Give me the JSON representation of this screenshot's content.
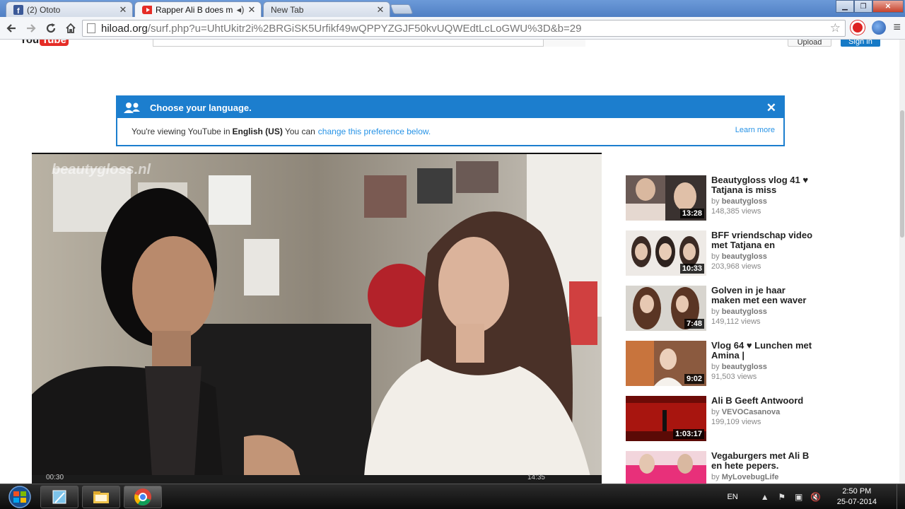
{
  "browser": {
    "tabs": [
      {
        "title": "(2) Ototo",
        "icon": "facebook-icon",
        "active": false
      },
      {
        "title": "Rapper Ali B does m",
        "icon": "youtube-icon",
        "active": true
      },
      {
        "title": "New Tab",
        "icon": "",
        "active": false
      }
    ],
    "url_host": "hiload.org",
    "url_path": "/surf.php?u=UhtUkitr2i%2BRGiSK5Urfikf49wQPPYZGJF50kvUQWEdtLcLoGWU%3D&b=29"
  },
  "youtube": {
    "logo_text": "You",
    "logo_tube": "Tube",
    "upload_label": "Upload",
    "signin_label": "Sign in"
  },
  "language_banner": {
    "heading": "Choose your language.",
    "text_prefix": "You're viewing YouTube in",
    "language": "English (US)",
    "text_middle": "You can",
    "link_text": "change this preference below.",
    "learn_more": "Learn more"
  },
  "player": {
    "current_time": "00:30",
    "duration": "14:35"
  },
  "related": [
    {
      "title": "Beautygloss vlog 41 ♥ Tatjana is miss",
      "by": "by",
      "channel": "beautygloss",
      "views": "148,385 views",
      "duration": "13:28"
    },
    {
      "title": "BFF vriendschap video met Tatjana en",
      "by": "by",
      "channel": "beautygloss",
      "views": "203,968 views",
      "duration": "10:33"
    },
    {
      "title": "Golven in je haar maken met een waver",
      "by": "by",
      "channel": "beautygloss",
      "views": "149,112 views",
      "duration": "7:48"
    },
    {
      "title": "Vlog 64 ♥ Lunchen met Amina |",
      "by": "by",
      "channel": "beautygloss",
      "views": "91,503 views",
      "duration": "9:02"
    },
    {
      "title": "Ali B Geeft Antwoord",
      "by": "by",
      "channel": "VEVOCasanova",
      "views": "199,109 views",
      "duration": "1:03:17"
    },
    {
      "title": "Vegaburgers met Ali B en hete pepers.",
      "by": "by",
      "channel": "MyLovebugLife",
      "views": "",
      "duration": ""
    }
  ],
  "taskbar": {
    "language": "EN",
    "time": "2:50 PM",
    "date": "25-07-2014"
  },
  "colors": {
    "accent_blue": "#1c7ece",
    "youtube_red": "#e52d27"
  }
}
